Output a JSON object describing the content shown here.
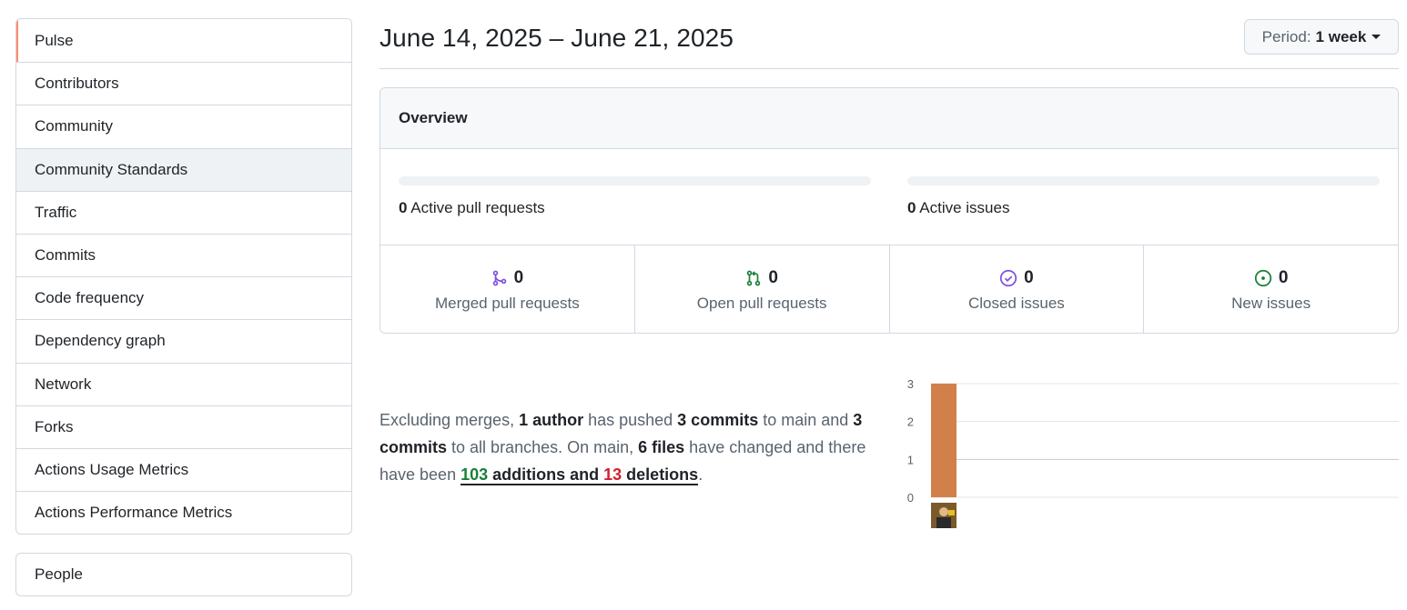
{
  "sidebar": {
    "items": [
      {
        "label": "Pulse"
      },
      {
        "label": "Contributors"
      },
      {
        "label": "Community"
      },
      {
        "label": "Community Standards"
      },
      {
        "label": "Traffic"
      },
      {
        "label": "Commits"
      },
      {
        "label": "Code frequency"
      },
      {
        "label": "Dependency graph"
      },
      {
        "label": "Network"
      },
      {
        "label": "Forks"
      },
      {
        "label": "Actions Usage Metrics"
      },
      {
        "label": "Actions Performance Metrics"
      }
    ],
    "people_label": "People"
  },
  "header": {
    "date_range": "June 14, 2025 – June 21, 2025",
    "period_prefix": "Period:",
    "period_value": "1 week"
  },
  "overview": {
    "title": "Overview",
    "active_prs_count": "0",
    "active_prs_label": "Active pull requests",
    "active_issues_count": "0",
    "active_issues_label": "Active issues",
    "stats": [
      {
        "count": "0",
        "label": "Merged pull requests",
        "icon": "git-merge-icon",
        "color": "#8250df"
      },
      {
        "count": "0",
        "label": "Open pull requests",
        "icon": "git-pull-request-icon",
        "color": "#1a7f37"
      },
      {
        "count": "0",
        "label": "Closed issues",
        "icon": "issue-closed-icon",
        "color": "#8250df"
      },
      {
        "count": "0",
        "label": "New issues",
        "icon": "issue-opened-icon",
        "color": "#1a7f37"
      }
    ]
  },
  "summary": {
    "t1": "Excluding merges, ",
    "authors": "1 author",
    "t2": " has pushed ",
    "commits_main": "3 commits",
    "t3": " to main and ",
    "commits_all": "3 commits",
    "t4": " to all branches. On main, ",
    "files": "6 files",
    "t5": " have changed and there have been ",
    "additions_num": "103",
    "additions_word": " additions",
    "and_word": " and ",
    "deletions_num": "13",
    "deletions_word": " deletions",
    "end": "."
  },
  "chart_data": {
    "type": "bar",
    "categories": [
      "author-1"
    ],
    "values": [
      3
    ],
    "ylim": [
      0,
      3
    ],
    "yticks": [
      "0",
      "1",
      "2",
      "3"
    ],
    "bar_color": "#d2804a"
  }
}
